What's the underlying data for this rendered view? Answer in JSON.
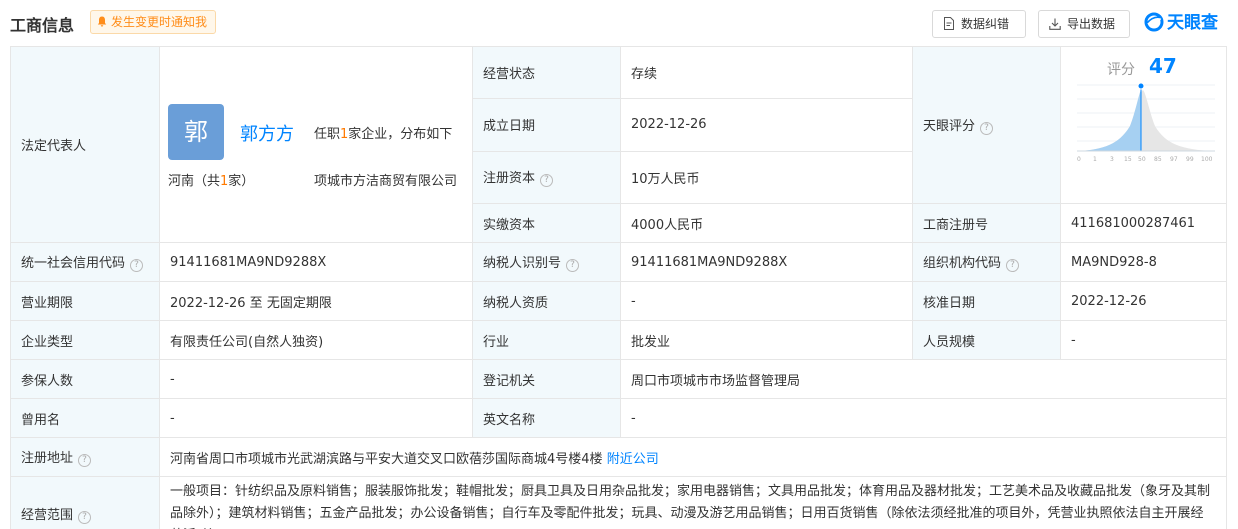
{
  "header": {
    "title": "工商信息",
    "notify_label": "发生变更时通知我",
    "correct_label": "数据纠错",
    "export_label": "导出数据",
    "logo_text": "天眼查"
  },
  "legal": {
    "label": "法定代表人",
    "avatar_char": "郭",
    "name": "郭方方",
    "desc_pre": "任职",
    "desc_count": "1",
    "desc_post": "家企业，分布如下",
    "prov_pre": "河南（共",
    "prov_count": "1",
    "prov_post": "家）",
    "company": "项城市方洁商贸有限公司"
  },
  "score": {
    "label": "天眼评分",
    "score_label": "评分",
    "score_value": "47",
    "ticks": [
      "0",
      "1",
      "3",
      "15",
      "50",
      "85",
      "97",
      "99",
      "100"
    ]
  },
  "fields": {
    "status_label": "经营状态",
    "status_value": "存续",
    "founded_label": "成立日期",
    "founded_value": "2022-12-26",
    "capital_label": "注册资本",
    "capital_value": "10万人民币",
    "paid_label": "实缴资本",
    "paid_value": "4000人民币",
    "regno_label": "工商注册号",
    "regno_value": "411681000287461",
    "credit_label": "统一社会信用代码",
    "credit_value": "91411681MA9ND9288X",
    "taxid_label": "纳税人识别号",
    "taxid_value": "91411681MA9ND9288X",
    "org_label": "组织机构代码",
    "org_value": "MA9ND928-8",
    "term_label": "营业期限",
    "term_value": "2022-12-26 至 无固定期限",
    "taxqual_label": "纳税人资质",
    "taxqual_value": "-",
    "approve_label": "核准日期",
    "approve_value": "2022-12-26",
    "type_label": "企业类型",
    "type_value": "有限责任公司(自然人独资)",
    "industry_label": "行业",
    "industry_value": "批发业",
    "staff_label": "人员规模",
    "staff_value": "-",
    "insured_label": "参保人数",
    "insured_value": "-",
    "authority_label": "登记机关",
    "authority_value": "周口市项城市市场监督管理局",
    "former_label": "曾用名",
    "former_value": "-",
    "english_label": "英文名称",
    "english_value": "-",
    "address_label": "注册地址",
    "address_value": "河南省周口市项城市光武湖滨路与平安大道交叉口欧蓓莎国际商城4号楼4楼",
    "nearby_label": "附近公司",
    "scope_label": "经营范围",
    "scope_value": "一般项目：针纺织品及原料销售；服装服饰批发；鞋帽批发；厨具卫具及日用杂品批发；家用电器销售；文具用品批发；体育用品及器材批发；工艺美术品及收藏品批发（象牙及其制品除外）；建筑材料销售；五金产品批发；办公设备销售；自行车及零配件批发；玩具、动漫及游艺用品销售；日用百货销售（除依法须经批准的项目外，凭营业执照依法自主开展经营活动）"
  },
  "colors": {
    "accent": "#0084ff",
    "label_bg": "#f2f9fc",
    "border": "#e6e6e6",
    "highlight": "#ff7a00"
  }
}
